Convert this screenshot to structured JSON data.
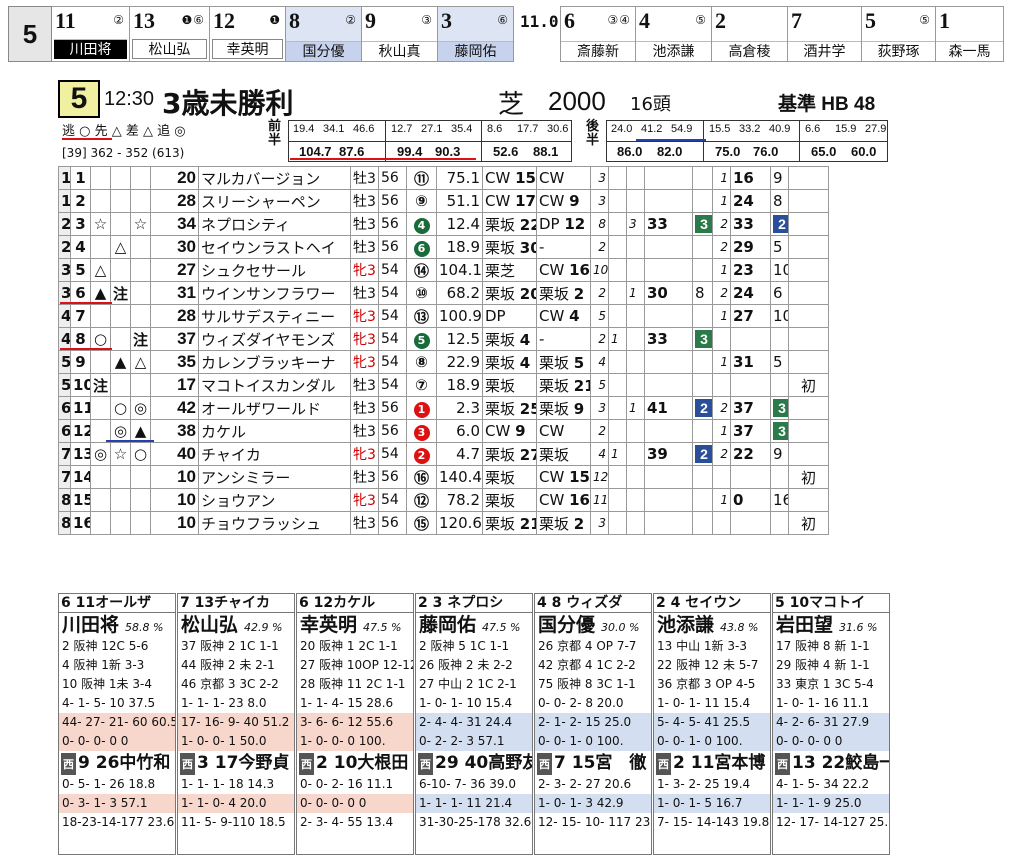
{
  "race_box": "5",
  "top_strip": [
    {
      "num": "11",
      "marks": "②",
      "jockey": "川田将",
      "style": "inv"
    },
    {
      "num": "13",
      "marks": "❶⑥",
      "jockey": "松山弘",
      "style": "box"
    },
    {
      "num": "12",
      "marks": "❶",
      "jockey": "幸英明",
      "style": "box"
    },
    {
      "num": "8",
      "marks": "②",
      "jockey": "国分優",
      "style": "plain"
    },
    {
      "num": "9",
      "marks": "③",
      "jockey": "秋山真",
      "style": "plain"
    },
    {
      "num": "3",
      "marks": "⑥",
      "jockey": "藤岡佑",
      "style": "plain"
    },
    {
      "num": "6",
      "marks": "③④",
      "jockey": "斎藤新",
      "style": "plain"
    },
    {
      "num": "4",
      "marks": "⑤",
      "jockey": "池添謙",
      "style": "plain"
    },
    {
      "num": "2",
      "marks": "",
      "jockey": "高倉稜",
      "style": "plain"
    },
    {
      "num": "7",
      "marks": "",
      "jockey": "酒井学",
      "style": "plain"
    },
    {
      "num": "5",
      "marks": "⑤",
      "jockey": "荻野琢",
      "style": "plain"
    },
    {
      "num": "1",
      "marks": "",
      "jockey": "森一馬",
      "style": "plain"
    }
  ],
  "strip_mid": "11.0",
  "race": {
    "number": "5",
    "time": "12:30",
    "name": "3歳未勝利",
    "surface": "芝",
    "distance": "2000",
    "field": "16頭",
    "base": "基準 HB 48",
    "styles": "逃 ○ 先 △ 差 △ 追 ◎",
    "rank": "[39]  362 - 352  (613)"
  },
  "laps": {
    "front_label": "前半",
    "front_top": [
      "19.4",
      "34.1",
      "46.6",
      "12.7",
      "27.1",
      "35.4",
      "8.6",
      "17.7",
      "30.6"
    ],
    "front_bot": [
      "104.7",
      "87.6",
      "99.4",
      "90.3",
      "52.6",
      "88.1"
    ],
    "back_label": "後半",
    "back_top": [
      "24.0",
      "41.2",
      "54.9",
      "15.5",
      "33.2",
      "40.9",
      "6.6",
      "15.9",
      "27.9"
    ],
    "back_bot": [
      "86.0",
      "82.0",
      "75.0",
      "76.0",
      "65.0",
      "60.0"
    ]
  },
  "entries": [
    {
      "waku": "1",
      "no": "1",
      "m1": "",
      "m2": "",
      "m3": "",
      "score": "20",
      "name": "マルカバージョン",
      "sex": "牡3",
      "f": false,
      "wt": "56",
      "pop": "⑪",
      "odds": "75.1",
      "t1": "CW",
      "v1": "15",
      "t2": "CW",
      "v2": "",
      "r": "3",
      "a": "",
      "b": "",
      "c": "",
      "d": "",
      "e": "1",
      "f2": "16",
      "g": "9",
      "h": ""
    },
    {
      "waku": "1",
      "no": "2",
      "m1": "",
      "m2": "",
      "m3": "",
      "score": "28",
      "name": "スリーシャーペン",
      "sex": "牡3",
      "f": false,
      "wt": "56",
      "pop": "⑨",
      "odds": "51.1",
      "t1": "CW",
      "v1": "17",
      "t2": "CW",
      "v2": "9",
      "r": "3",
      "a": "",
      "b": "",
      "c": "",
      "d": "",
      "e": "1",
      "f2": "24",
      "g": "8",
      "h": ""
    },
    {
      "waku": "2",
      "no": "3",
      "m1": "☆",
      "m2": "",
      "m3": "☆",
      "score": "34",
      "name": "ネプロシティ",
      "sex": "牡3",
      "f": false,
      "wt": "56",
      "pop": "4",
      "odds": "12.4",
      "t1": "栗坂",
      "v1": "22",
      "t2": "DP",
      "v2": "12",
      "r": "8",
      "a": "",
      "b": "3",
      "c": "33",
      "d": "3",
      "e": "2",
      "f2": "33",
      "g": "2",
      "h": ""
    },
    {
      "waku": "2",
      "no": "4",
      "m1": "",
      "m2": "△",
      "m3": "",
      "score": "30",
      "name": "セイウンラストヘイ",
      "sex": "牡3",
      "f": false,
      "wt": "56",
      "pop": "6",
      "odds": "18.9",
      "t1": "栗坂",
      "v1": "30",
      "t2": "-",
      "v2": "",
      "r": "2",
      "a": "",
      "b": "",
      "c": "",
      "d": "",
      "e": "2",
      "f2": "29",
      "g": "5",
      "h": ""
    },
    {
      "waku": "3",
      "no": "5",
      "m1": "△",
      "m2": "",
      "m3": "",
      "score": "27",
      "name": "シュクセサール",
      "sex": "牝3",
      "f": true,
      "wt": "54",
      "pop": "⑭",
      "odds": "104.1",
      "t1": "栗芝",
      "v1": "",
      "t2": "CW",
      "v2": "16",
      "r": "10",
      "a": "",
      "b": "",
      "c": "",
      "d": "",
      "e": "1",
      "f2": "23",
      "g": "10",
      "h": ""
    },
    {
      "waku": "3",
      "no": "6",
      "m1": "▲",
      "m2": "注",
      "m3": "",
      "score": "31",
      "name": "ウインサンフラワー",
      "sex": "牡3",
      "f": false,
      "wt": "54",
      "pop": "⑩",
      "odds": "68.2",
      "t1": "栗坂",
      "v1": "20",
      "t2": "栗坂",
      "v2": "2",
      "r": "2",
      "a": "",
      "b": "1",
      "c": "30",
      "d": "8",
      "e": "2",
      "f2": "24",
      "g": "6",
      "h": ""
    },
    {
      "waku": "4",
      "no": "7",
      "m1": "",
      "m2": "",
      "m3": "",
      "score": "28",
      "name": "サルサデスティニー",
      "sex": "牝3",
      "f": true,
      "wt": "54",
      "pop": "⑬",
      "odds": "100.9",
      "t1": "DP",
      "v1": "",
      "t2": "CW",
      "v2": "4",
      "r": "5",
      "a": "",
      "b": "",
      "c": "",
      "d": "",
      "e": "1",
      "f2": "27",
      "g": "10",
      "h": ""
    },
    {
      "waku": "4",
      "no": "8",
      "m1": "○",
      "m2": "",
      "m3": "注",
      "score": "37",
      "name": "ウィズダイヤモンズ",
      "sex": "牝3",
      "f": true,
      "wt": "54",
      "pop": "5",
      "odds": "12.5",
      "t1": "栗坂",
      "v1": "4",
      "t2": "-",
      "v2": "",
      "r": "2",
      "a": "1",
      "b": "",
      "c": "33",
      "d": "3",
      "e": "",
      "f2": "",
      "g": "",
      "h": ""
    },
    {
      "waku": "5",
      "no": "9",
      "m1": "",
      "m2": "▲",
      "m3": "△",
      "score": "35",
      "name": "カレンブラッキーナ",
      "sex": "牝3",
      "f": true,
      "wt": "54",
      "pop": "⑧",
      "odds": "22.9",
      "t1": "栗坂",
      "v1": "4",
      "t2": "栗坂",
      "v2": "5",
      "r": "4",
      "a": "",
      "b": "",
      "c": "",
      "d": "",
      "e": "1",
      "f2": "31",
      "g": "5",
      "h": ""
    },
    {
      "waku": "5",
      "no": "10",
      "m1": "注",
      "m2": "",
      "m3": "",
      "score": "17",
      "name": "マコトイスカンダル",
      "sex": "牡3",
      "f": false,
      "wt": "54",
      "pop": "⑦",
      "odds": "18.9",
      "t1": "栗坂",
      "v1": "",
      "t2": "栗坂",
      "v2": "21",
      "r": "5",
      "a": "",
      "b": "",
      "c": "",
      "d": "",
      "e": "",
      "f2": "",
      "g": "",
      "h": "初"
    },
    {
      "waku": "6",
      "no": "11",
      "m1": "",
      "m2": "○",
      "m3": "◎",
      "score": "42",
      "name": "オールザワールド",
      "sex": "牡3",
      "f": false,
      "wt": "56",
      "pop": "1",
      "odds": "2.3",
      "t1": "栗坂",
      "v1": "25",
      "t2": "栗坂",
      "v2": "9",
      "r": "3",
      "a": "",
      "b": "1",
      "c": "41",
      "d": "2",
      "e": "2",
      "f2": "37",
      "g": "3",
      "h": ""
    },
    {
      "waku": "6",
      "no": "12",
      "m1": "",
      "m2": "◎",
      "m3": "▲",
      "score": "38",
      "name": "カケル",
      "sex": "牡3",
      "f": false,
      "wt": "56",
      "pop": "3",
      "odds": "6.0",
      "t1": "CW",
      "v1": "9",
      "t2": "CW",
      "v2": "",
      "r": "2",
      "a": "",
      "b": "",
      "c": "",
      "d": "",
      "e": "1",
      "f2": "37",
      "g": "3",
      "h": ""
    },
    {
      "waku": "7",
      "no": "13",
      "m1": "◎",
      "m2": "☆",
      "m3": "○",
      "score": "40",
      "name": "チャイカ",
      "sex": "牝3",
      "f": true,
      "wt": "54",
      "pop": "2",
      "odds": "4.7",
      "t1": "栗坂",
      "v1": "27",
      "t2": "栗坂",
      "v2": "",
      "r": "4",
      "a": "1",
      "b": "",
      "c": "39",
      "d": "2",
      "e": "2",
      "f2": "22",
      "g": "9",
      "h": ""
    },
    {
      "waku": "7",
      "no": "14",
      "m1": "",
      "m2": "",
      "m3": "",
      "score": "10",
      "name": "アンシミラー",
      "sex": "牡3",
      "f": false,
      "wt": "56",
      "pop": "⑯",
      "odds": "140.4",
      "t1": "栗坂",
      "v1": "",
      "t2": "CW",
      "v2": "15",
      "r": "12",
      "a": "",
      "b": "",
      "c": "",
      "d": "",
      "e": "",
      "f2": "",
      "g": "",
      "h": "初"
    },
    {
      "waku": "8",
      "no": "15",
      "m1": "",
      "m2": "",
      "m3": "",
      "score": "10",
      "name": "ショウアン",
      "sex": "牝3",
      "f": true,
      "wt": "54",
      "pop": "⑫",
      "odds": "78.2",
      "t1": "栗坂",
      "v1": "",
      "t2": "CW",
      "v2": "16",
      "r": "11",
      "a": "",
      "b": "",
      "c": "",
      "d": "",
      "e": "1",
      "f2": "0",
      "g": "16",
      "h": ""
    },
    {
      "waku": "8",
      "no": "16",
      "m1": "",
      "m2": "",
      "m3": "",
      "score": "10",
      "name": "チョウフラッシュ",
      "sex": "牡3",
      "f": false,
      "wt": "56",
      "pop": "⑮",
      "odds": "120.6",
      "t1": "栗坂",
      "v1": "21",
      "t2": "栗坂",
      "v2": "2",
      "r": "3",
      "a": "",
      "b": "",
      "c": "",
      "d": "",
      "e": "",
      "f2": "",
      "g": "",
      "h": "初"
    }
  ],
  "jockeys": [
    {
      "hd": "6 11オールザ",
      "name": "川田将",
      "pct": "58.8 %",
      "l1": "2 阪神 12C 5-6",
      "l2": "4 阪神 1新 3-3",
      "l3": "10 阪神 1未 3-4",
      "l4": "4- 1- 5- 10 37.5",
      "l5": "44- 27- 21- 60 60.5",
      "l6": "0- 0- 0- 0 0",
      "tn": "9 26中竹和",
      "t1": "0- 5- 1- 26 18.8",
      "t2": "0- 3- 1- 3 57.1",
      "t3": "18-23-14-177 23.6"
    },
    {
      "hd": "7 13チャイカ",
      "name": "松山弘",
      "pct": "42.9 %",
      "l1": "37 阪神 2 1C 1-1",
      "l2": "44 阪神 2 未 2-1",
      "l3": "46 京都 3 3C 2-2",
      "l4": "1- 1- 1- 23 8.0",
      "l5": "17- 16- 9- 40 51.2",
      "l6": "1- 0- 0- 1 50.0",
      "tn": "3 17今野貞",
      "t1": "1- 1- 1- 18 14.3",
      "t2": "1- 1- 0- 4 20.0",
      "t3": "11- 5- 9-110 18.5"
    },
    {
      "hd": "6 12カケル",
      "name": "幸英明",
      "pct": "47.5 %",
      "l1": "20 阪神 1 2C 1-1",
      "l2": "27 阪神 10OP 12-12",
      "l3": "28 阪神 11 2C 1-1",
      "l4": "1- 1- 4- 15 28.6",
      "l5": "3- 6- 6- 12 55.6",
      "l6": "1- 0- 0- 0 100.",
      "tn": "2 10大根田",
      "t1": "0- 0- 2- 16 11.1",
      "t2": "0- 0- 0- 0 0",
      "t3": "2- 3- 4- 55 13.4"
    },
    {
      "hd": "2 3 ネプロシ",
      "name": "藤岡佑",
      "pct": "47.5 %",
      "l1": "2 阪神 5 1C 1-1",
      "l2": "26 阪神 2 未 2-2",
      "l3": "27 中山 2 1C 2-1",
      "l4": "1- 0- 1- 10 15.4",
      "l5": "2- 4- 4- 31 24.4",
      "l6": "0- 2- 2- 3 57.1",
      "tn": "29 40高野友",
      "t1": "6-10- 7- 36 39.0",
      "t2": "1- 1- 1- 11 21.4",
      "t3": "31-30-25-178 32.6"
    },
    {
      "hd": "4 8 ウィズダ",
      "name": "国分優",
      "pct": "30.0 %",
      "l1": "26 京都 4 OP 7-7",
      "l2": "42 京都 4 1C 2-2",
      "l3": "75 阪神 8 3C 1-1",
      "l4": "0- 0- 2- 8 20.0",
      "l5": "2- 1- 2- 15 25.0",
      "l6": "0- 0- 1- 0 100.",
      "tn": "7 15宮　徹",
      "t1": "2- 3- 2- 27 20.6",
      "t2": "1- 0- 1- 3 42.9",
      "t3": "12- 15- 10- 117 23.7"
    },
    {
      "hd": "2 4 セイウン",
      "name": "池添謙",
      "pct": "43.8 %",
      "l1": "13 中山 1新 3-3",
      "l2": "22 阪神 12 未 5-7",
      "l3": "36 京都 3 OP 4-5",
      "l4": "1- 0- 1- 11 15.4",
      "l5": "5- 4- 5- 41 25.5",
      "l6": "0- 0- 1- 0 100.",
      "tn": "2 11宮本博",
      "t1": "1- 3- 2- 25 19.4",
      "t2": "1- 0- 1- 5 16.7",
      "t3": "7- 15- 14-143 19.8"
    },
    {
      "hd": "5 10マコトイ",
      "name": "岩田望",
      "pct": "31.6 %",
      "l1": "17 阪神 8 新 1-1",
      "l2": "29 阪神 4 新 1-1",
      "l3": "33 東京 1 3C 5-4",
      "l4": "1- 0- 1- 16 11.1",
      "l5": "4- 2- 6- 31 27.9",
      "l6": "0- 0- 0- 0 0",
      "tn": "13 22鮫島一",
      "t1": "4- 1- 5- 34 22.2",
      "t2": "1- 1- 1- 9 25.0",
      "t3": "12- 17- 14-127 25.0"
    }
  ]
}
